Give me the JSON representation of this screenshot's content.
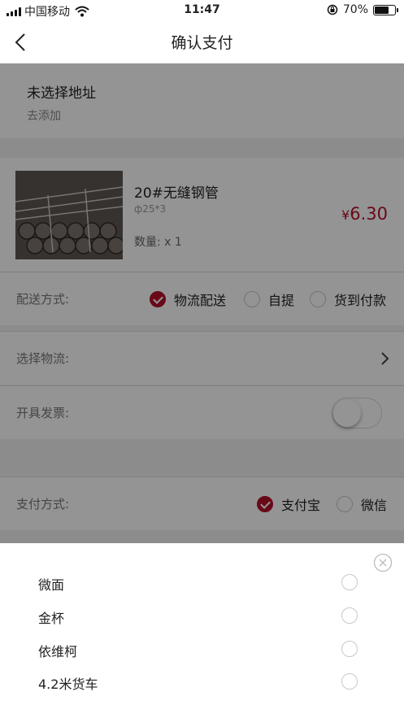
{
  "status_bar": {
    "carrier": "中国移动",
    "time": "11:47",
    "battery": "70%",
    "battery_level": 0.7,
    "icons": [
      "signal-icon",
      "wifi-icon",
      "orientation-lock-icon",
      "battery-icon"
    ]
  },
  "nav": {
    "title": "确认支付",
    "back_icon": "chevron-left-icon"
  },
  "address": {
    "title": "未选择地址",
    "action": "去添加"
  },
  "product": {
    "name": "20#无缝钢管",
    "spec": "ф25*3",
    "quantity": "数量: x 1",
    "currency": "¥",
    "price": "6.30"
  },
  "delivery": {
    "label": "配送方式:",
    "options": [
      {
        "label": "物流配送",
        "selected": true
      },
      {
        "label": "自提",
        "selected": false
      },
      {
        "label": "货到付款",
        "selected": false
      }
    ]
  },
  "logistics": {
    "label": "选择物流:"
  },
  "invoice": {
    "label": "开具发票:",
    "enabled": false
  },
  "payment": {
    "label": "支付方式:",
    "options": [
      {
        "label": "支付宝",
        "selected": true
      },
      {
        "label": "微信",
        "selected": false
      }
    ]
  },
  "sheet": {
    "items": [
      {
        "label": "微面",
        "selected": false
      },
      {
        "label": "金杯",
        "selected": false
      },
      {
        "label": "依维柯",
        "selected": false
      },
      {
        "label": "4.2米货车",
        "selected": false
      }
    ]
  },
  "colors": {
    "accent": "#b5102a",
    "overlay": "rgba(0,0,0,0.42)"
  }
}
